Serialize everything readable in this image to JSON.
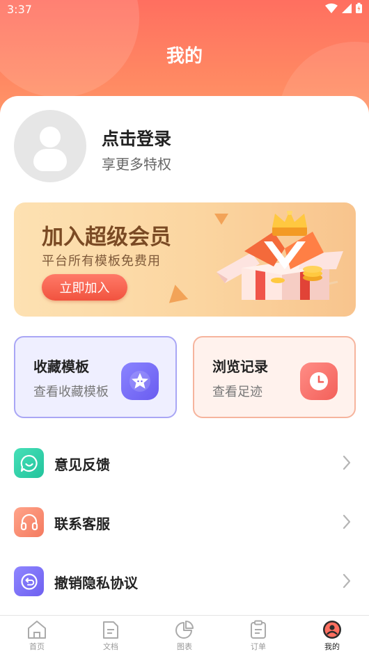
{
  "status_bar": {
    "time": "3:37"
  },
  "header": {
    "title": "我的"
  },
  "profile": {
    "login_title": "点击登录",
    "login_sub": "享更多特权"
  },
  "vip": {
    "title": "加入超级会员",
    "subtitle": "平台所有模板免费用",
    "button": "立即加入"
  },
  "quick": [
    {
      "title": "收藏模板",
      "sub": "查看收藏模板",
      "icon": "star-icon"
    },
    {
      "title": "浏览记录",
      "sub": "查看足迹",
      "icon": "clock-icon"
    }
  ],
  "menu": [
    {
      "label": "意见反馈",
      "icon": "chat-icon"
    },
    {
      "label": "联系客服",
      "icon": "headset-icon"
    },
    {
      "label": "撤销隐私协议",
      "icon": "revoke-icon"
    }
  ],
  "tabs": [
    {
      "label": "首页",
      "icon": "home-icon"
    },
    {
      "label": "文档",
      "icon": "document-icon"
    },
    {
      "label": "图表",
      "icon": "pie-chart-icon"
    },
    {
      "label": "订单",
      "icon": "clipboard-icon"
    },
    {
      "label": "我的",
      "icon": "profile-icon",
      "active": true
    }
  ],
  "colors": {
    "accent": "#ff6f60",
    "vip_button": "#f1533f"
  }
}
